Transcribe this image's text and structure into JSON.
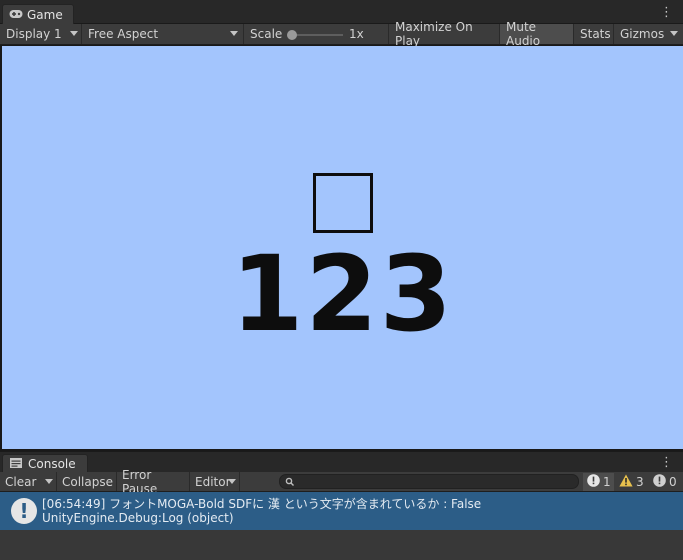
{
  "game_panel": {
    "tab_label": "Game",
    "toolbar": {
      "display": "Display 1",
      "aspect": "Free Aspect",
      "scale_label": "Scale",
      "scale_value": "1x",
      "maximize_on_play": "Maximize On Play",
      "mute_audio": "Mute Audio",
      "stats": "Stats",
      "gizmos": "Gizmos"
    },
    "viewport": {
      "background_color": "#a3c5fd",
      "glyph_box": "",
      "number_text": "123"
    }
  },
  "console_panel": {
    "tab_label": "Console",
    "toolbar": {
      "clear": "Clear",
      "collapse": "Collapse",
      "error_pause": "Error Pause",
      "editor": "Editor",
      "search_placeholder": "",
      "info_count": "1",
      "warning_count": "3",
      "error_count": "0"
    },
    "log_entries": [
      {
        "line1": "[06:54:49] フォントMOGA-Bold SDFに 漢 という文字が含まれているか : False",
        "line2": "UnityEngine.Debug:Log (object)",
        "selected_color": "#2c5d87"
      }
    ]
  },
  "icons": {
    "game_tab_icon": "gamepad-icon",
    "console_tab_icon": "console-icon",
    "search_icon": "search-icon",
    "info_icon": "info-icon",
    "warning_icon": "warning-icon"
  }
}
